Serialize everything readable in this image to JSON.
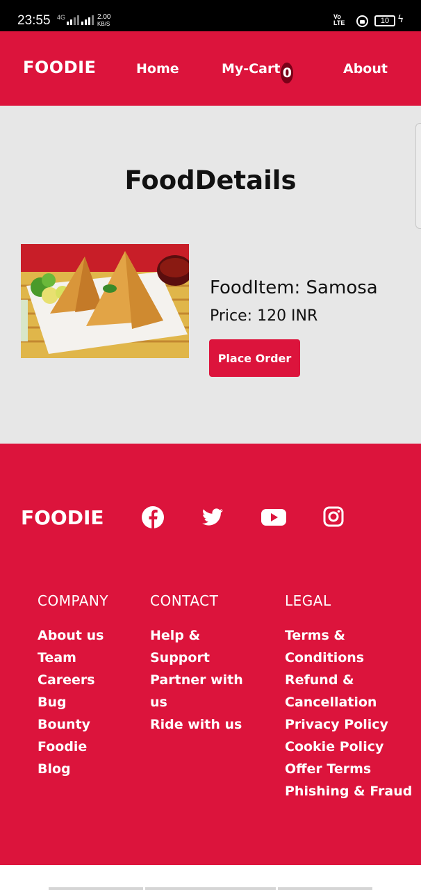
{
  "status_bar": {
    "time": "23:55",
    "network": "4G",
    "speed_value": "2.00",
    "speed_unit": "KB/S",
    "volte": "Vo",
    "lte": "LTE",
    "battery": "10"
  },
  "navbar": {
    "brand": "FOODIE",
    "home": "Home",
    "cart": "My-Cart",
    "cart_count": "0",
    "about": "About"
  },
  "main": {
    "title": "FoodDetails",
    "food_item": "FoodItem: Samosa",
    "price": "Price: 120 INR",
    "order_button": "Place Order"
  },
  "footer": {
    "brand": "FOODIE",
    "social_icons": [
      "facebook-icon",
      "twitter-icon",
      "youtube-icon",
      "instagram-icon"
    ],
    "columns": {
      "company": {
        "heading": "COMPANY",
        "links": [
          "About us",
          "Team",
          "Careers",
          "Bug",
          "Bounty",
          "Foodie",
          "Blog"
        ]
      },
      "contact": {
        "heading": "CONTACT",
        "links": [
          "Help &",
          "Support",
          "Partner with",
          "us",
          "Ride with us"
        ]
      },
      "legal": {
        "heading": "LEGAL",
        "links": [
          "Terms &",
          "Conditions",
          "Refund &",
          "Cancellation",
          "Privacy Policy",
          "Cookie Policy",
          "Offer Terms",
          "Phishing & Fraud"
        ]
      }
    }
  },
  "colors": {
    "brand_red": "#dc143c",
    "main_bg": "#e7e7e7"
  }
}
